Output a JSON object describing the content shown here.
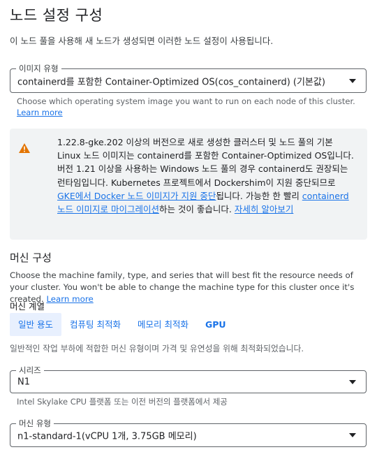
{
  "page": {
    "title": "노드 설정 구성",
    "intro": "이 노드 풀을 사용해 새 노드가 생성되면 이러한 노드 설정이 사용됩니다."
  },
  "image_type": {
    "label": "이미지 유형",
    "value": "containerd를 포함한 Container-Optimized OS(cos_containerd) (기본값)",
    "hint": "Choose which operating system image you want to run on each node of this cluster.",
    "hint_link": "Learn more"
  },
  "notice": {
    "icon": "warning-icon",
    "text_1": "1.22.8-gke.202 이상의 버전으로 새로 생성한 클러스터 및 노드 풀의 기본 Linux 노드 이미지는 containerd를 포함한 Container-Optimized OS입니다. 버전 1.21 이상을 사용하는 Windows 노드 풀의 경우 containerd도 권장되는 런타임입니다. Kubernetes 프로젝트에서 Dockershim이 지원 중단되므로 ",
    "link_1": "GKE에서 Docker 노드 이미지가 지원 중단",
    "text_2": "됩니다. 가능한 한 빨리 ",
    "link_2": "containerd 노드 이미지로 마이그레이션",
    "text_3": "하는 것이 좋습니다. ",
    "link_3": "자세히 알아보기"
  },
  "machine": {
    "section_title": "머신 구성",
    "description": "Choose the machine family, type, and series that will best fit the resource needs of your cluster. You won't be able to change the machine type for this cluster once it's created.",
    "description_link": "Learn more",
    "family_label": "머신 계열",
    "tabs": [
      {
        "label": "일반 용도",
        "active": true
      },
      {
        "label": "컴퓨팅 최적화",
        "active": false
      },
      {
        "label": "메모리 최적화",
        "active": false
      },
      {
        "label": "GPU",
        "active": false
      }
    ],
    "tab_description": "일반적인 작업 부하에 적합한 머신 유형이며 가격 및 유연성을 위해 최적화되었습니다.",
    "series": {
      "label": "시리즈",
      "value": "N1",
      "hint": "Intel Skylake CPU 플랫폼 또는 이전 버전의 플랫폼에서 제공"
    },
    "machine_type": {
      "label": "머신 유형",
      "value": "n1-standard-1(vCPU 1개, 3.75GB 메모리)"
    }
  },
  "colors": {
    "accent": "#1a73e8",
    "warning": "#e37400",
    "notice_bg": "#f1f3f4",
    "active_tab_bg": "#e8f0fe"
  }
}
